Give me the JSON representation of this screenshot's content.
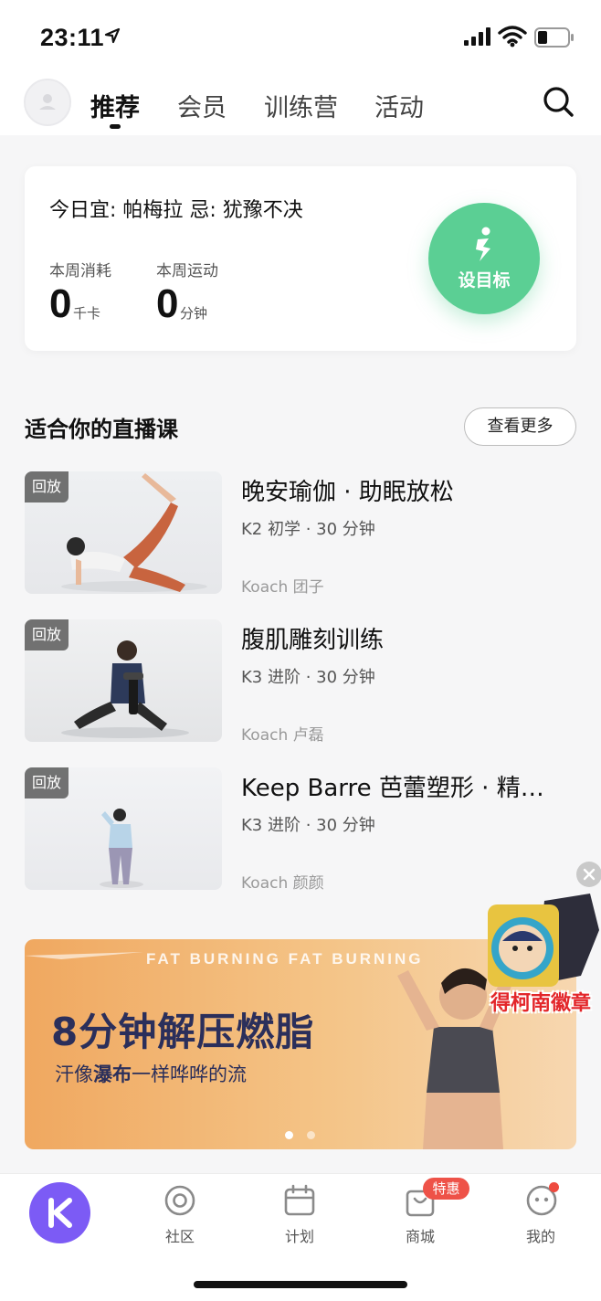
{
  "status_bar": {
    "time": "23:11"
  },
  "top_nav": {
    "tabs": [
      {
        "label": "推荐",
        "active": true
      },
      {
        "label": "会员",
        "active": false
      },
      {
        "label": "训练营",
        "active": false
      },
      {
        "label": "活动",
        "active": false
      }
    ]
  },
  "stats_card": {
    "fortune": "今日宜: 帕梅拉 忌: 犹豫不决",
    "weekly_calories_label": "本周消耗",
    "weekly_calories_value": "0",
    "weekly_calories_unit": "千卡",
    "weekly_exercise_label": "本周运动",
    "weekly_exercise_value": "0",
    "weekly_exercise_unit": "分钟",
    "goal_button_label": "设目标"
  },
  "live_section": {
    "title": "适合你的直播课",
    "more_label": "查看更多",
    "courses": [
      {
        "badge": "回放",
        "title": "晚安瑜伽 · 助眠放松",
        "meta": "K2 初学 · 30 分钟",
        "coach": "Koach 团子"
      },
      {
        "badge": "回放",
        "title": "腹肌雕刻训练",
        "meta": "K3 进阶 · 30 分钟",
        "coach": "Koach 卢磊"
      },
      {
        "badge": "回放",
        "title": "Keep Barre 芭蕾塑形 · 精…",
        "meta": "K3 进阶 · 30 分钟",
        "coach": "Koach 颜颜"
      }
    ]
  },
  "banner": {
    "top_text": "FAT BURNING FAT BURNING",
    "headline": "8分钟解压燃脂",
    "sub_prefix": "汗像",
    "sub_bold": "瀑布",
    "sub_suffix": "一样哗哗的流",
    "active_dot": 0
  },
  "floating_ad": {
    "text": "得柯南徽章"
  },
  "tab_bar": {
    "items": [
      {
        "label": "社区"
      },
      {
        "label": "计划"
      },
      {
        "label": "商城",
        "badge": "特惠"
      },
      {
        "label": "我的"
      }
    ]
  },
  "colors": {
    "accent_green": "#5bcf94",
    "brand_purple": "#7c5bf5",
    "badge_red": "#ee5248"
  }
}
